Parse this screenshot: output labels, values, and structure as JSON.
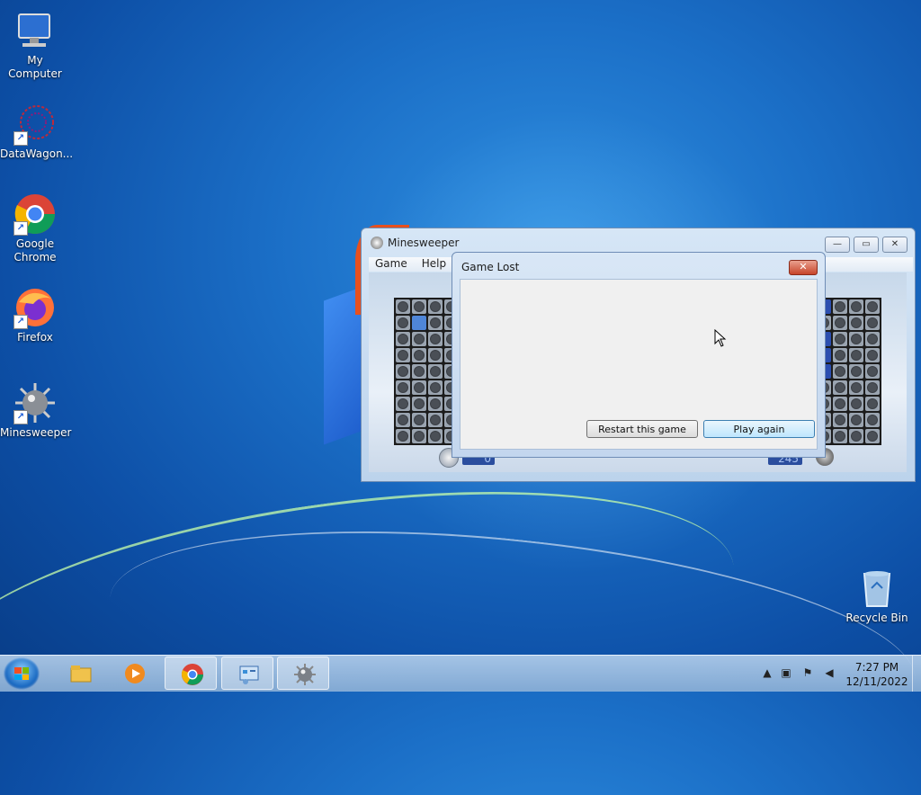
{
  "desktop": {
    "icons": [
      {
        "label": "My Computer"
      },
      {
        "label": "DataWagon..."
      },
      {
        "label": "Google Chrome"
      },
      {
        "label": "Firefox"
      },
      {
        "label": "Minesweeper"
      },
      {
        "label": "Recycle Bin"
      }
    ]
  },
  "minesweeper": {
    "title": "Minesweeper",
    "menu": [
      "Game",
      "Help"
    ],
    "time": "0",
    "mines": "245",
    "window_buttons": {
      "minimize": "—",
      "restore": "▭",
      "close": "✕"
    }
  },
  "dialog": {
    "title": "Game Lost",
    "close": "✕",
    "restart_label": "Restart this game",
    "play_again_label": "Play again"
  },
  "taskbar": {
    "time": "7:27 PM",
    "date": "12/11/2022",
    "apps": [
      "File Explorer",
      "Windows Media Player",
      "Google Chrome",
      "Control Panel",
      "Minesweeper"
    ],
    "tray_icons": [
      "show-hidden-icons",
      "network-icon",
      "action-center-flag-icon",
      "volume-icon"
    ]
  },
  "colors": {
    "desktop": "#1b6fc7",
    "board_cell": "#9aa4b0",
    "revealed_cell": "#4f86d8",
    "counter_bg": "#2b4e9e"
  }
}
